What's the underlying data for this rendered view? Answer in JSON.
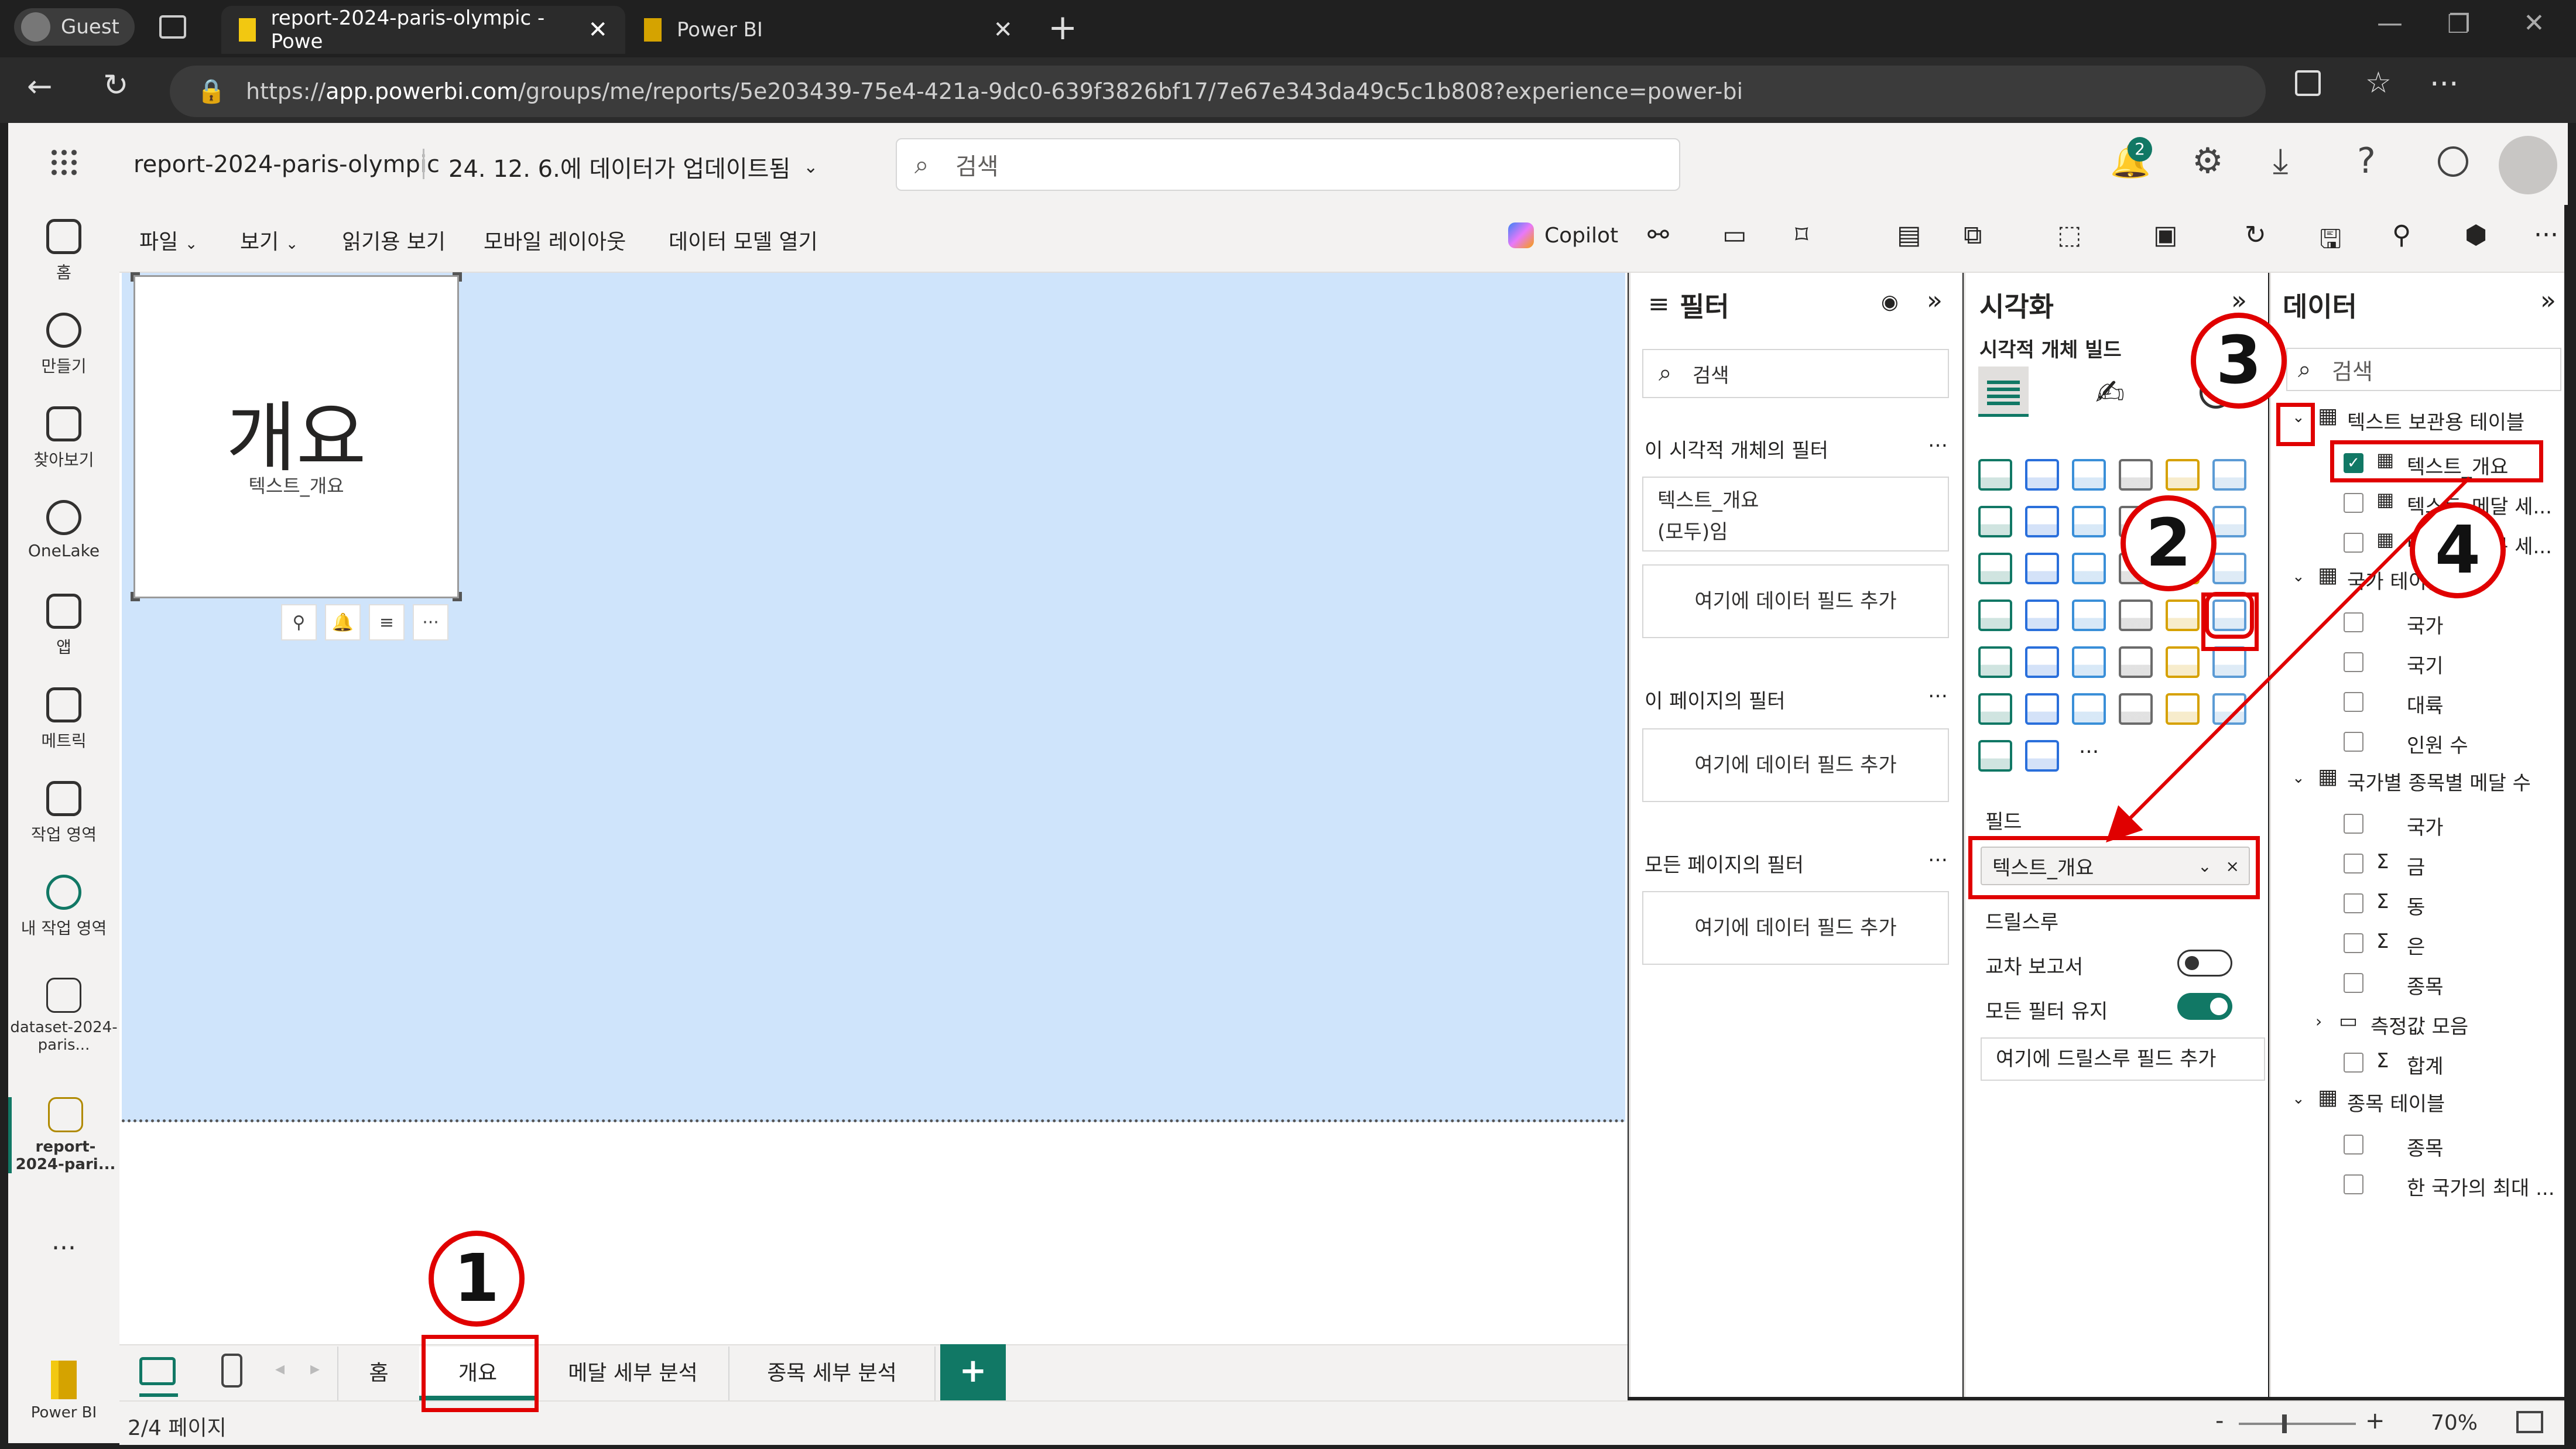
{
  "browser": {
    "profile": "Guest",
    "tabs": [
      {
        "title": "report-2024-paris-olympic - Powe"
      },
      {
        "title": "Power BI"
      }
    ],
    "url_prefix": "https://",
    "url_host": "app.powerbi.com",
    "url_path": "/groups/me/reports/5e203439-75e4-421a-9dc0-639f3826bf17/7e67e343da49c5c1b808?experience=power-bi"
  },
  "header": {
    "report_name": "report-2024-paris-olympic",
    "updated_text": "24. 12. 6.에 데이터가 업데이트됨",
    "search_placeholder": "검색",
    "notification_count": "2"
  },
  "leftnav": [
    {
      "label": "홈",
      "icon": "home-icon"
    },
    {
      "label": "만들기",
      "icon": "create-icon"
    },
    {
      "label": "찾아보기",
      "icon": "browse-icon"
    },
    {
      "label": "OneLake",
      "icon": "onelake-icon"
    },
    {
      "label": "앱",
      "icon": "apps-icon"
    },
    {
      "label": "메트릭",
      "icon": "metrics-icon"
    },
    {
      "label": "작업 영역",
      "icon": "workspaces-icon"
    },
    {
      "label": "내 작업 영역",
      "icon": "my-workspace-icon"
    },
    {
      "label": "dataset-2024-paris...",
      "icon": "dataset-icon"
    },
    {
      "label": "report-2024-pari...",
      "icon": "report-icon"
    },
    {
      "label": "...",
      "icon": "more-icon"
    },
    {
      "label": "Power BI",
      "icon": "powerbi-icon"
    }
  ],
  "ribbon": {
    "file": "파일",
    "view": "보기",
    "reading_view": "읽기용 보기",
    "mobile_layout": "모바일 레이아웃",
    "open_model": "데이터 모델 열기",
    "copilot": "Copilot"
  },
  "card": {
    "value": "개요",
    "label": "텍스트_개요"
  },
  "filters": {
    "title": "필터",
    "search_placeholder": "검색",
    "visual_section": "이 시각적 개체의 필터",
    "visual_filter_name": "텍스트_개요",
    "visual_filter_state": "(모두)임",
    "add_field": "여기에 데이터 필드 추가",
    "page_section": "이 페이지의 필터",
    "all_pages_section": "모든 페이지의 필터"
  },
  "viz": {
    "title": "시각화",
    "build_label": "시각적 개체 빌드",
    "fields_label": "필드",
    "field_value": "텍스트_개요",
    "drillthrough_label": "드릴스루",
    "cross_report": "교차 보고서",
    "keep_filters": "모든 필터 유지",
    "drill_add": "여기에 드릴스루 필드 추가",
    "cross_report_on": false,
    "keep_filters_on": true
  },
  "data": {
    "title": "데이터",
    "search_placeholder": "검색",
    "tables": [
      {
        "name": "텍스트 보관용 테이블",
        "fields": [
          "텍스트_개요",
          "텍스트_메달 세...",
          "텍스트_종목 세..."
        ]
      },
      {
        "name": "국가 테이블",
        "fields": [
          "국가",
          "국기",
          "대륙",
          "인원 수"
        ]
      },
      {
        "name": "국가별 종목별 메달 수",
        "fields": [
          "국가",
          "금",
          "동",
          "은",
          "종목",
          "측정값 모음",
          "합계"
        ]
      },
      {
        "name": "종목 테이블",
        "fields": [
          "종목",
          "한 국가의 최대 ..."
        ]
      }
    ]
  },
  "pages": [
    {
      "label": "홈"
    },
    {
      "label": "개요"
    },
    {
      "label": "메달 세부 분석"
    },
    {
      "label": "종목 세부 분석"
    }
  ],
  "status": {
    "page_indicator": "2/4 페이지",
    "zoom": "70%"
  },
  "annotations": [
    "1",
    "2",
    "3",
    "4"
  ],
  "colors": {
    "accent": "#117865",
    "annotation": "#e00000",
    "canvas_selected": "#cfe4fb"
  }
}
